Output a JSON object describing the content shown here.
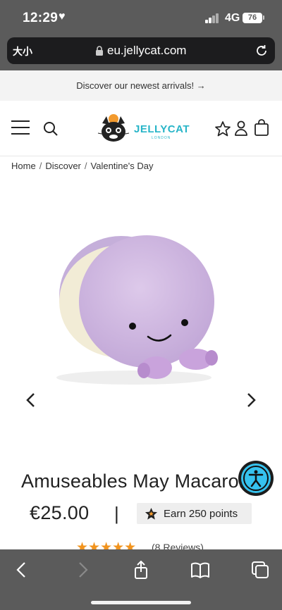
{
  "status_bar": {
    "time": "12:29",
    "heart": "♥",
    "network": "4G",
    "battery": "76"
  },
  "browser": {
    "text_size_label": "大小",
    "url": "eu.jellycat.com"
  },
  "promo": {
    "text": "Discover our newest arrivals! →"
  },
  "header": {
    "logo_text": "JELLYCAT",
    "logo_sub": "LONDON"
  },
  "breadcrumb": {
    "items": [
      "Home",
      "Discover",
      "Valentine's Day"
    ],
    "separator": "/"
  },
  "product": {
    "title": "Amuseables May Macaron",
    "price": "€25.00",
    "price_separator": "|",
    "points_label": "Earn 250 points",
    "stars": "★★★★★",
    "reviews": "(8 Reviews)",
    "rating": 5
  },
  "colors": {
    "accent": "#28b5c8",
    "star": "#f2941e",
    "accessibility": "#36c2ee",
    "chrome": "#5b5b5b"
  },
  "icons": [
    "menu-icon",
    "search-icon",
    "favorite-star-icon",
    "account-icon",
    "bag-icon",
    "chevron-left-icon",
    "chevron-right-icon",
    "accessibility-icon",
    "back-icon",
    "forward-icon",
    "share-icon",
    "bookmarks-icon",
    "tabs-icon"
  ]
}
